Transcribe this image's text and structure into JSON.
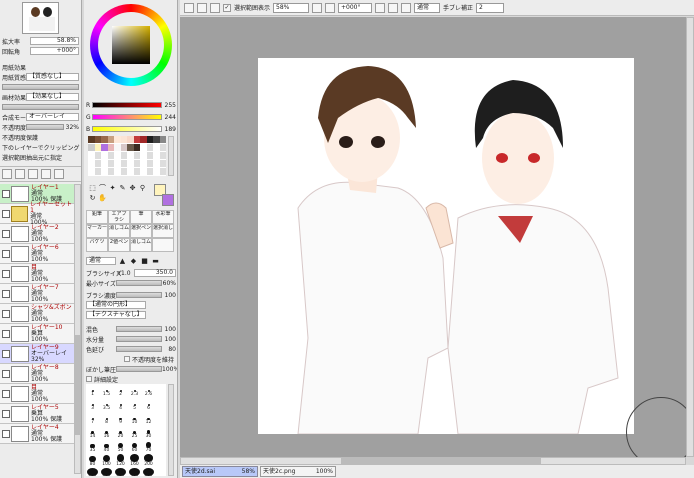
{
  "navigator": {
    "zoom_label": "拡大率",
    "zoom": "58.8%",
    "angle_label": "回転角",
    "angle": "+000°"
  },
  "paper": {
    "effect_label": "用紙効果",
    "texture_label": "用紙質感",
    "texture": "【質感なし】",
    "effect2_label": "画材効果",
    "effect2": "【効果なし】",
    "blend_label": "合成モード",
    "blend": "オーバーレイ",
    "opacity_label": "不透明度",
    "opacity": "32%"
  },
  "options": {
    "opt1": "不透明度保護",
    "opt2": "下のレイヤーでクリッピング",
    "opt3": "選択範囲抽出元に指定"
  },
  "layers": [
    {
      "name": "レイヤー1",
      "mode": "通常",
      "opacity": "100%",
      "extra": "保護",
      "state": "sel"
    },
    {
      "name": "レイヤーセット1",
      "mode": "通常",
      "opacity": "100%",
      "extra": "",
      "state": "folder"
    },
    {
      "name": "レイヤー2",
      "mode": "通常",
      "opacity": "100%",
      "extra": "",
      "state": ""
    },
    {
      "name": "レイヤー6",
      "mode": "通常",
      "opacity": "100%",
      "extra": "",
      "state": ""
    },
    {
      "name": "目",
      "mode": "通常",
      "opacity": "100%",
      "extra": "",
      "state": ""
    },
    {
      "name": "レイヤー7",
      "mode": "通常",
      "opacity": "100%",
      "extra": "",
      "state": ""
    },
    {
      "name": "シャツ&ズボン",
      "mode": "通常",
      "opacity": "100%",
      "extra": "",
      "state": ""
    },
    {
      "name": "レイヤー10",
      "mode": "乗算",
      "opacity": "100%",
      "extra": "",
      "state": ""
    },
    {
      "name": "レイヤー9",
      "mode": "オーバーレイ",
      "opacity": "32%",
      "extra": "",
      "state": "sel2"
    },
    {
      "name": "レイヤー8",
      "mode": "通常",
      "opacity": "100%",
      "extra": "",
      "state": ""
    },
    {
      "name": "目",
      "mode": "通常",
      "opacity": "100%",
      "extra": "",
      "state": ""
    },
    {
      "name": "レイヤー5",
      "mode": "乗算",
      "opacity": "100%",
      "extra": "保護",
      "state": ""
    },
    {
      "name": "レイヤー4",
      "mode": "通常",
      "opacity": "100%",
      "extra": "保護",
      "state": ""
    }
  ],
  "color": {
    "r_label": "R",
    "r": "255",
    "g_label": "G",
    "g": "244",
    "b_label": "B",
    "b": "189",
    "fg": "#fff4bd",
    "bg": "#ffffff"
  },
  "tools": [
    {
      "label": "鉛筆"
    },
    {
      "label": "エアブラシ"
    },
    {
      "label": "筆"
    },
    {
      "label": "水彩筆"
    },
    {
      "label": "マーカー"
    },
    {
      "label": "消しゴム"
    },
    {
      "label": "選択ペン"
    },
    {
      "label": "選択消し"
    },
    {
      "label": "バケツ"
    },
    {
      "label": "2値ペン"
    },
    {
      "label": "消しゴム"
    },
    {
      "label": ""
    }
  ],
  "brush": {
    "mode": "通常",
    "size_label": "ブラシサイズ",
    "size_mult": "×1.0",
    "size": "350.0",
    "min_label": "最小サイズ",
    "min": "60%",
    "density_label": "ブラシ濃度",
    "density": "100",
    "shape": "【通常の円形】",
    "texture": "【テクスチャなし】",
    "mix_label": "混色",
    "mix": "100",
    "water_label": "水分量",
    "water": "100",
    "stretch_label": "色延び",
    "stretch": "80",
    "keep_opacity": "不透明度を維持",
    "blur_label": "ぼかし筆圧",
    "blur": "100%",
    "detail": "詳細設定"
  },
  "brush_sizes": [
    "1",
    "1.5",
    "2",
    "2.3",
    "2.6",
    "3",
    "3.5",
    "4",
    "5",
    "6",
    "7",
    "8",
    "9",
    "10",
    "12",
    "14",
    "16",
    "20",
    "25",
    "30",
    "35",
    "40",
    "50",
    "60",
    "70",
    "80",
    "100",
    "120",
    "160",
    "200",
    "250",
    "300",
    "350",
    "400",
    "500"
  ],
  "toolbar": {
    "checkbox": "選択範囲表示",
    "zoom": "58%",
    "angle": "+000°",
    "blend": "通常",
    "stab_label": "手ブレ補正",
    "stab": "2"
  },
  "tabs": [
    {
      "name": "天使2d.sai",
      "zoom": "58%"
    },
    {
      "name": "天使2c.png",
      "zoom": "100%"
    }
  ]
}
